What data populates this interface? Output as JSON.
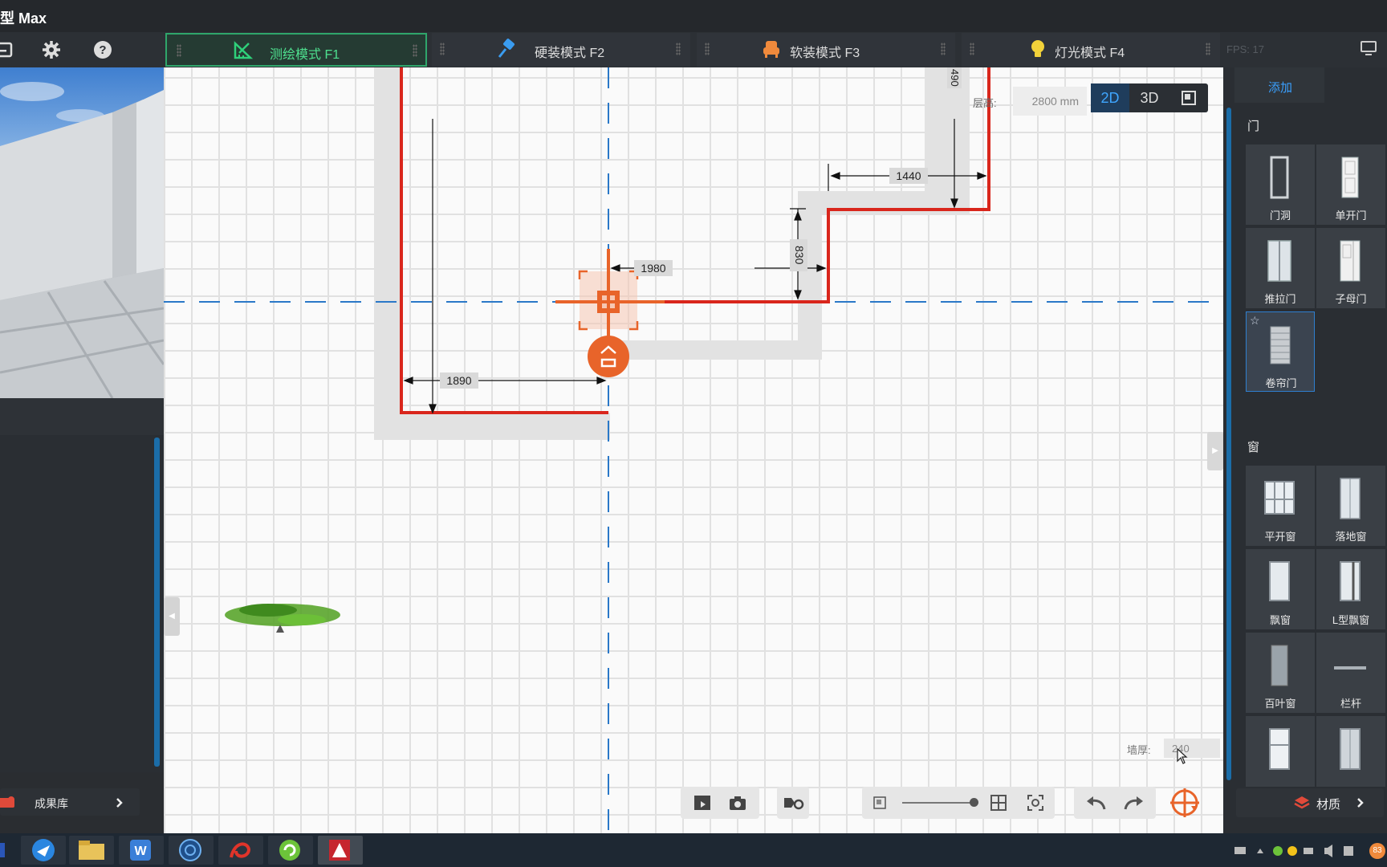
{
  "app": {
    "title": "型 Max"
  },
  "toolbar_icons": [
    "save-icon",
    "gear-icon",
    "help-icon"
  ],
  "mode_tabs": [
    {
      "label": "测绘模式  F1",
      "icon": "measure-icon",
      "active": true,
      "color": "#2fa66b"
    },
    {
      "label": "硬装模式  F2",
      "icon": "brush-icon",
      "active": false,
      "color": "#3a9cf0"
    },
    {
      "label": "软装模式  F3",
      "icon": "sofa-icon",
      "active": false,
      "color": "#f08a3c"
    },
    {
      "label": "灯光模式  F4",
      "icon": "bulb-icon",
      "active": false,
      "color": "#f2d23a"
    }
  ],
  "fps_label": "FPS:  17",
  "canvas": {
    "floor_height_label": "层高:",
    "floor_height_value": "2800 mm",
    "view_buttons": [
      "2D",
      "3D",
      "plan-icon"
    ],
    "active_view": "2D",
    "dimensions": {
      "d1890": "1890",
      "d1980": "1980",
      "d830": "830",
      "d1440": "1440",
      "d490": "490"
    },
    "wall_thickness_label": "墙厚:",
    "wall_thickness_value": "240",
    "accent": "#e8642a",
    "wall_color": "#d9261c",
    "axis_color": "#2a78c8"
  },
  "left_panel": {
    "library_label": "成果库"
  },
  "right_panel": {
    "tab_label": "添加",
    "sections": [
      {
        "title": "门",
        "items": [
          "门洞",
          "单开门",
          "推拉门",
          "子母门",
          "卷帘门"
        ]
      },
      {
        "title": "窗",
        "items": [
          "平开窗",
          "落地窗",
          "飘窗",
          "L型飘窗",
          "百叶窗",
          "栏杆",
          "",
          ""
        ]
      }
    ],
    "selected_item": "卷帘门",
    "material_label": "材质"
  },
  "taskbar": {
    "apps": [
      "start-icon",
      "bird-app-icon",
      "folder-icon",
      "wps-icon",
      "browser-icon",
      "scribble-app-icon",
      "refresh-app-icon",
      "autocad-icon"
    ],
    "tray_badge": "83"
  }
}
